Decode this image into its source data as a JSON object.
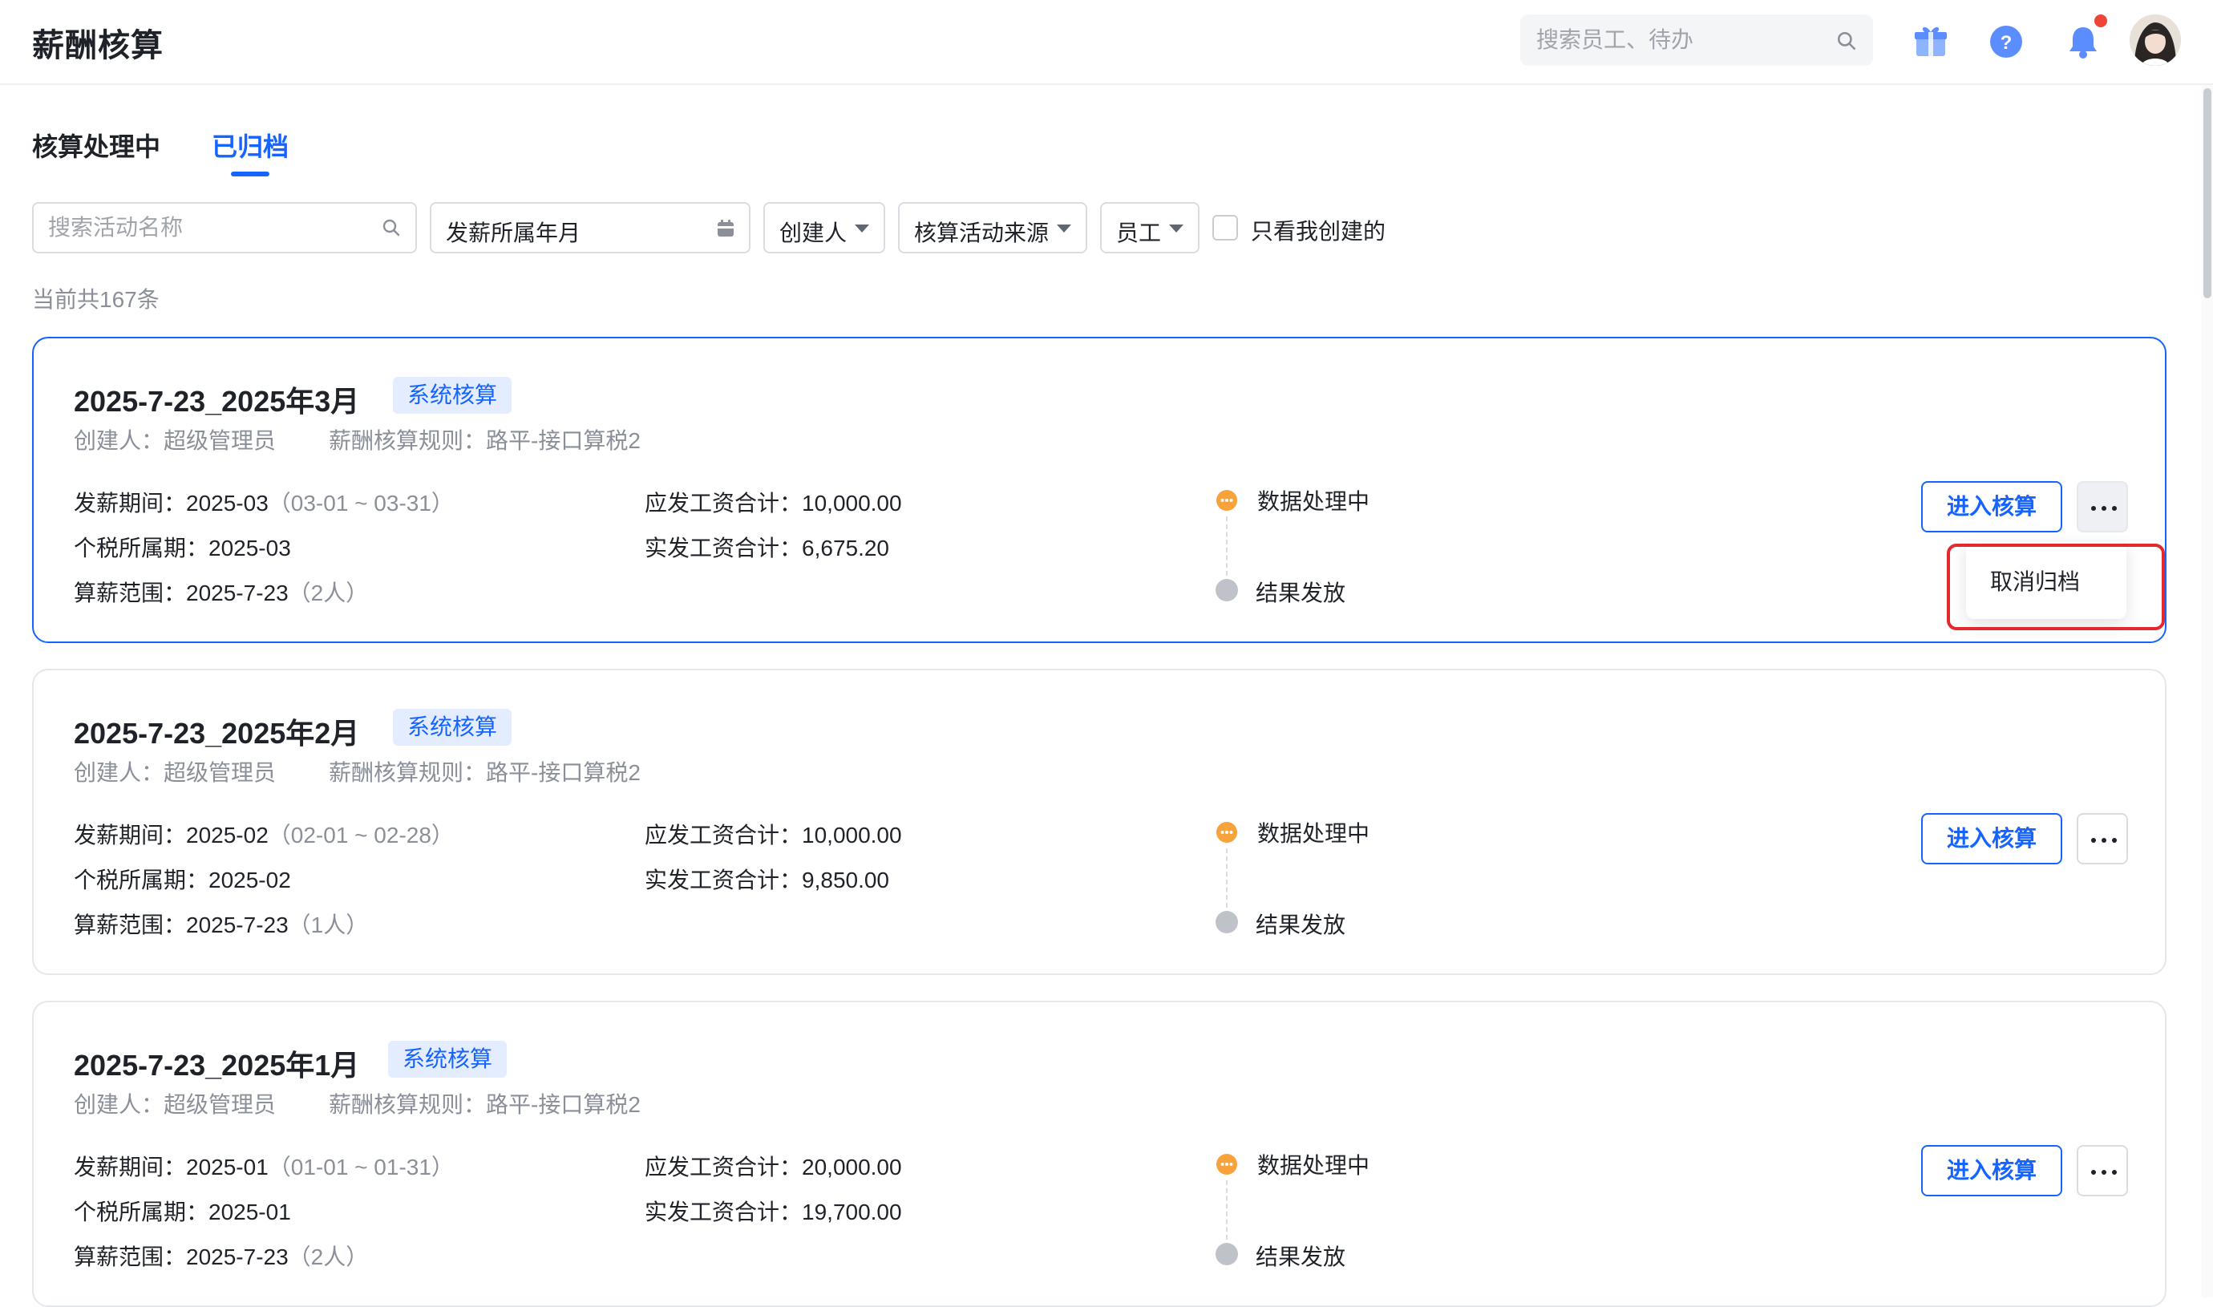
{
  "app": {
    "title": "薪酬核算"
  },
  "header": {
    "search_placeholder": "搜索员工、待办"
  },
  "tabs": [
    {
      "label": "核算处理中",
      "active": false
    },
    {
      "label": "已归档",
      "active": true
    }
  ],
  "filters": {
    "search_placeholder": "搜索活动名称",
    "pay_month": "发薪所属年月",
    "creator": "创建人",
    "source": "核算活动来源",
    "employee": "员工",
    "only_mine": "只看我创建的",
    "only_mine_checked": false
  },
  "count_text": "当前共167条",
  "cards": [
    {
      "title": "2025-7-23_2025年3月",
      "badge": "系统核算",
      "creator": "创建人：超级管理员",
      "rule": "薪酬核算规则：路平-接口算税2",
      "pay_period_label": "发薪期间：",
      "pay_period": "2025-03",
      "pay_period_range": "（03-01 ~ 03-31）",
      "tax_period_label": "个税所属期：",
      "tax_period": "2025-03",
      "scope_label": "算薪范围：",
      "scope": "2025-7-23",
      "scope_count": "（2人）",
      "gross_label": "应发工资合计：",
      "gross": "10,000.00",
      "net_label": "实发工资合计：",
      "net": "6,675.20",
      "status_current": "数据处理中",
      "status_next": "结果发放",
      "enter_button": "进入核算"
    },
    {
      "title": "2025-7-23_2025年2月",
      "badge": "系统核算",
      "creator": "创建人：超级管理员",
      "rule": "薪酬核算规则：路平-接口算税2",
      "pay_period_label": "发薪期间：",
      "pay_period": "2025-02",
      "pay_period_range": "（02-01 ~ 02-28）",
      "tax_period_label": "个税所属期：",
      "tax_period": "2025-02",
      "scope_label": "算薪范围：",
      "scope": "2025-7-23",
      "scope_count": "（1人）",
      "gross_label": "应发工资合计：",
      "gross": "10,000.00",
      "net_label": "实发工资合计：",
      "net": "9,850.00",
      "status_current": "数据处理中",
      "status_next": "结果发放",
      "enter_button": "进入核算"
    },
    {
      "title": "2025-7-23_2025年1月",
      "badge": "系统核算",
      "creator": "创建人：超级管理员",
      "rule": "薪酬核算规则：路平-接口算税2",
      "pay_period_label": "发薪期间：",
      "pay_period": "2025-01",
      "pay_period_range": "（01-01 ~ 01-31）",
      "tax_period_label": "个税所属期：",
      "tax_period": "2025-01",
      "scope_label": "算薪范围：",
      "scope": "2025-7-23",
      "scope_count": "（2人）",
      "gross_label": "应发工资合计：",
      "gross": "20,000.00",
      "net_label": "实发工资合计：",
      "net": "19,700.00",
      "status_current": "数据处理中",
      "status_next": "结果发放",
      "enter_button": "进入核算"
    }
  ],
  "more_menu": {
    "items": [
      "取消归档"
    ]
  },
  "colors": {
    "accent": "#1664ff",
    "badge_bg": "#e4edff",
    "status_processing": "#f7a23b",
    "status_pending": "#bfc3c9",
    "highlight": "#e5282c"
  },
  "icons": [
    "search-icon",
    "gift-icon",
    "help-icon",
    "bell-icon",
    "calendar-icon",
    "chevron-down-icon",
    "more-icon"
  ]
}
